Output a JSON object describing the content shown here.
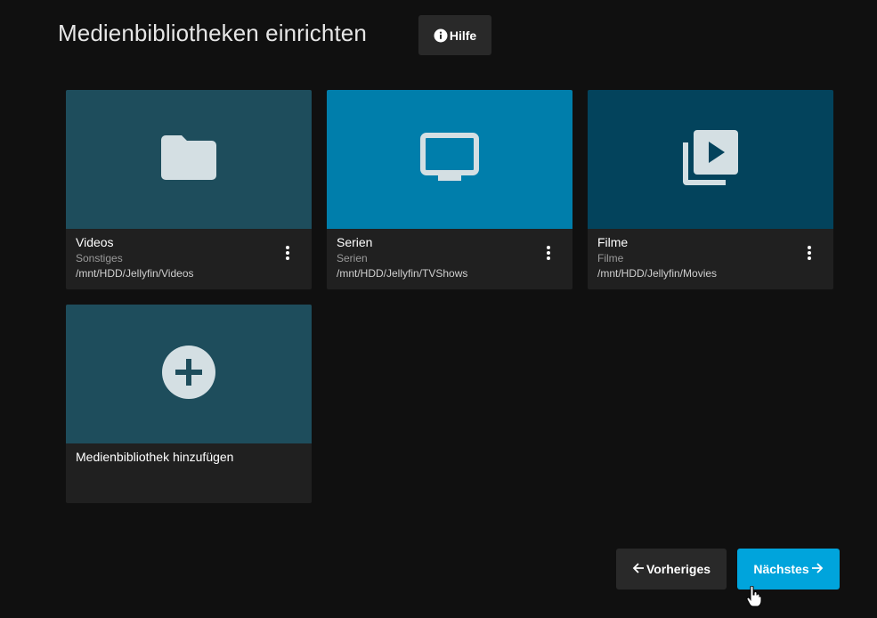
{
  "header": {
    "title": "Medienbibliotheken einrichten",
    "help_label": "Hilfe"
  },
  "libraries": [
    {
      "title": "Videos",
      "type": "Sonstiges",
      "path": "/mnt/HDD/Jellyfin/Videos",
      "icon": "folder-icon",
      "color": "#1e4d5c"
    },
    {
      "title": "Serien",
      "type": "Serien",
      "path": "/mnt/HDD/Jellyfin/TVShows",
      "icon": "tv-icon",
      "color": "#007eab"
    },
    {
      "title": "Filme",
      "type": "Filme",
      "path": "/mnt/HDD/Jellyfin/Movies",
      "icon": "video-library-icon",
      "color": "#03435c"
    }
  ],
  "add_card": {
    "title": "Medienbibliothek hinzufügen",
    "icon": "add-circle-icon",
    "color": "#1e4d5c"
  },
  "navigation": {
    "prev_label": "Vorheriges",
    "next_label": "Nächstes",
    "prev_arrow": "🡐",
    "next_arrow": "🡒"
  },
  "colors": {
    "background": "#101010",
    "card_footer": "#202020",
    "accent": "#00a4dc",
    "icon": "#d4dfe3"
  }
}
